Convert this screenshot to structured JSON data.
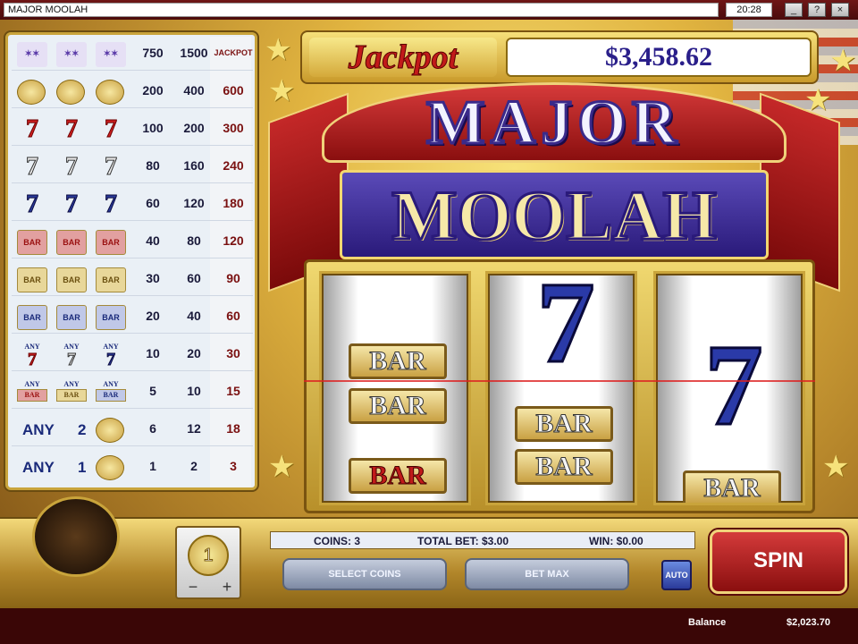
{
  "window": {
    "title": "MAJOR MOOLAH",
    "clock": "20:28",
    "buttons": [
      "minimize",
      "help",
      "close"
    ]
  },
  "jackpot": {
    "label": "Jackpot",
    "value": "$3,458.62"
  },
  "logo": {
    "line1": "MAJOR",
    "line2": "MOOLAH"
  },
  "paytable": {
    "header": [
      "750",
      "1500",
      "JACKPOT"
    ],
    "rows": [
      {
        "symbol": "gold-coin",
        "values": [
          "200",
          "400",
          "600"
        ]
      },
      {
        "symbol": "red-seven",
        "values": [
          "100",
          "200",
          "300"
        ]
      },
      {
        "symbol": "white-seven",
        "values": [
          "80",
          "160",
          "240"
        ]
      },
      {
        "symbol": "blue-seven",
        "values": [
          "60",
          "120",
          "180"
        ]
      },
      {
        "symbol": "red-bar",
        "values": [
          "40",
          "80",
          "120"
        ]
      },
      {
        "symbol": "gold-bar",
        "values": [
          "30",
          "60",
          "90"
        ]
      },
      {
        "symbol": "blue-bar",
        "values": [
          "20",
          "40",
          "60"
        ]
      },
      {
        "symbol": "any-seven",
        "values": [
          "10",
          "20",
          "30"
        ]
      },
      {
        "symbol": "any-bar",
        "values": [
          "5",
          "10",
          "15"
        ]
      },
      {
        "symbol": "any-2-coin",
        "values": [
          "6",
          "12",
          "18"
        ]
      },
      {
        "symbol": "any-1-coin",
        "values": [
          "1",
          "2",
          "3"
        ]
      }
    ],
    "any_label": "ANY",
    "any_two": "2",
    "any_one": "1"
  },
  "reels": [
    {
      "symbols": [
        "gold-bar",
        "gold-bar",
        "red-bar"
      ]
    },
    {
      "symbols": [
        "blue-seven",
        "gold-bar",
        "gold-bar"
      ]
    },
    {
      "symbols": [
        "blue-seven",
        "gold-bar"
      ]
    }
  ],
  "bar_text": "BAR",
  "seven_text": "7",
  "controls": {
    "coin_value": "1",
    "minus": "−",
    "plus": "+",
    "coins_label": "COINS: 3",
    "total_bet_label": "TOTAL BET: $3.00",
    "win_label": "WIN: $0.00",
    "select_coins": "SELECT COINS",
    "bet_max": "BET MAX",
    "auto": "AUTO",
    "spin": "SPIN"
  },
  "status": {
    "balance_label": "Balance",
    "balance_value": "$2,023.70"
  },
  "colors": {
    "accent_red": "#8a0f0f",
    "gold": "#c9a43b",
    "jackpot_blue": "#2a1f8a"
  }
}
